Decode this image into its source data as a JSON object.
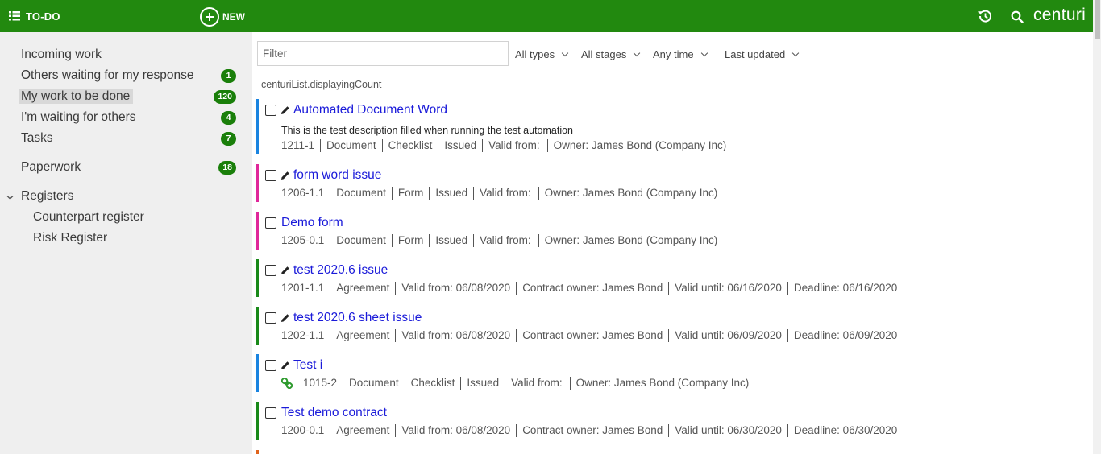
{
  "topbar": {
    "todo_label": "TO-DO",
    "new_label": "NEW",
    "brand": "centuri",
    "icons": [
      "grid-icon",
      "plus-circle-icon",
      "history-icon",
      "search-icon"
    ],
    "background": "#22890f"
  },
  "sidebar": {
    "items": [
      {
        "label": "Incoming work",
        "badge": null
      },
      {
        "label": "Others waiting for my response",
        "badge": "1"
      },
      {
        "label": "My work to be done",
        "badge": "120",
        "active": true
      },
      {
        "label": "I'm waiting for others",
        "badge": "4"
      },
      {
        "label": "Tasks",
        "badge": "7"
      },
      {
        "label": "Paperwork",
        "badge": "18"
      }
    ],
    "registers": {
      "label": "Registers",
      "children": [
        "Counterpart register",
        "Risk Register"
      ]
    }
  },
  "main": {
    "filter_placeholder": "Filter",
    "filters": [
      "All types",
      "All stages",
      "Any time",
      "Last updated"
    ],
    "count_label": "centuriList.displayingCount",
    "items": [
      {
        "title": "Automated Document Word",
        "has_pencil": true,
        "description": "This is the test description filled when running the test automation",
        "meta": [
          "1211-1",
          "Document",
          "Checklist",
          "Issued",
          "Valid from:",
          "Owner: James Bond (Company Inc)"
        ],
        "stripe_color": "#1a84e0"
      },
      {
        "title": "form word issue",
        "has_pencil": true,
        "meta": [
          "1206-1.1",
          "Document",
          "Form",
          "Issued",
          "Valid from:",
          "Owner: James Bond (Company Inc)"
        ],
        "stripe_color": "#e0279a"
      },
      {
        "title": "Demo form",
        "has_pencil": false,
        "meta": [
          "1205-0.1",
          "Document",
          "Form",
          "Issued",
          "Valid from:",
          "Owner: James Bond (Company Inc)"
        ],
        "stripe_color": "#e0279a"
      },
      {
        "title": "test 2020.6 issue",
        "has_pencil": true,
        "meta": [
          "1201-1.1",
          "Agreement",
          "Valid from: 06/08/2020",
          "Contract owner: James Bond",
          "Valid until: 06/16/2020",
          "Deadline: 06/16/2020"
        ],
        "stripe_color": "#1a8a1a"
      },
      {
        "title": "test 2020.6 sheet issue",
        "has_pencil": true,
        "meta": [
          "1202-1.1",
          "Agreement",
          "Valid from: 06/08/2020",
          "Contract owner: James Bond",
          "Valid until: 06/09/2020",
          "Deadline: 06/09/2020"
        ],
        "stripe_color": "#1a8a1a"
      },
      {
        "title": "Test i",
        "has_pencil": true,
        "has_link": true,
        "meta": [
          "1015-2",
          "Document",
          "Checklist",
          "Issued",
          "Valid from:",
          "Owner: James Bond (Company Inc)"
        ],
        "stripe_color": "#1a84e0"
      },
      {
        "title": "Test demo contract",
        "has_pencil": false,
        "meta": [
          "1200-0.1",
          "Agreement",
          "Valid from: 06/08/2020",
          "Contract owner: James Bond",
          "Valid until: 06/30/2020",
          "Deadline: 06/30/2020"
        ],
        "stripe_color": "#1a8a1a"
      }
    ]
  }
}
